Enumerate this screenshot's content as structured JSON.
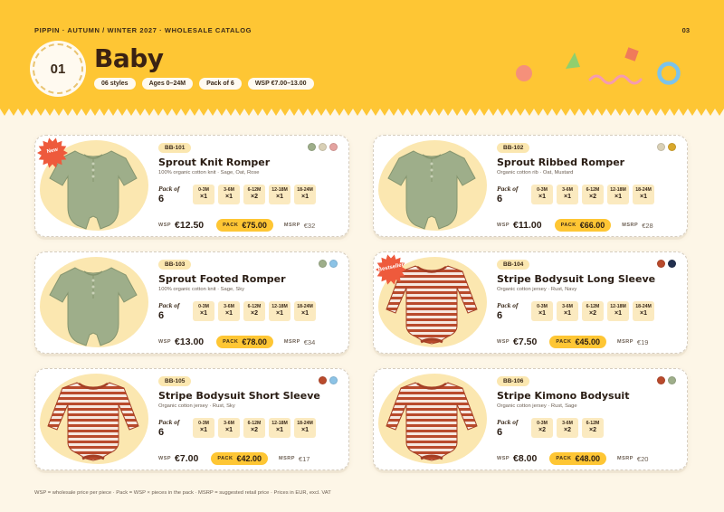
{
  "header": {
    "eyebrow": "PIPPIN · AUTUMN / WINTER 2027 · WHOLESALE CATALOG",
    "page_number": "03",
    "section_number": "01",
    "title": "Baby",
    "pills": [
      "06 styles",
      "Ages 0–24M",
      "Pack of 6",
      "WSP €7.00–13.00"
    ]
  },
  "colors": {
    "header_bg": "#fec634",
    "page_bg": "#fdf6e7",
    "sage": "#9eae8a",
    "oatmeal": "#d9d0b6",
    "rose": "#e4a3a0",
    "mustard": "#d9a82c",
    "sky": "#8cc3e6",
    "rust": "#b94a2c",
    "navy": "#23304f",
    "sticker": "#ee5a3c"
  },
  "labels": {
    "pack_of": "Pack of",
    "wsp": "WSP",
    "pack": "PACK",
    "msrp": "MSRP"
  },
  "products": [
    {
      "sku": "BB-101",
      "name": "Sprout Knit Romper",
      "desc": "100% organic cotton knit · Sage, Oat, Rose",
      "badge": "New",
      "swatches": [
        "#9eae8a",
        "#d9d0b6",
        "#e4a3a0"
      ],
      "garment": "romper-sage",
      "pack": "6",
      "sizes": [
        {
          "size": "0-3M",
          "qty": "×1"
        },
        {
          "size": "3-6M",
          "qty": "×1"
        },
        {
          "size": "6-12M",
          "qty": "×2"
        },
        {
          "size": "12-18M",
          "qty": "×1"
        },
        {
          "size": "18-24M",
          "qty": "×1"
        }
      ],
      "wsp": "€12.50",
      "pack_price": "€75.00",
      "msrp": "€32"
    },
    {
      "sku": "BB-102",
      "name": "Sprout Ribbed Romper",
      "desc": "Organic cotton rib · Oat, Mustard",
      "badge": "",
      "swatches": [
        "#d9d0b6",
        "#d9a82c"
      ],
      "garment": "romper-sage",
      "pack": "6",
      "sizes": [
        {
          "size": "0-3M",
          "qty": "×1"
        },
        {
          "size": "3-6M",
          "qty": "×1"
        },
        {
          "size": "6-12M",
          "qty": "×2"
        },
        {
          "size": "12-18M",
          "qty": "×1"
        },
        {
          "size": "18-24M",
          "qty": "×1"
        }
      ],
      "wsp": "€11.00",
      "pack_price": "€66.00",
      "msrp": "€28"
    },
    {
      "sku": "BB-103",
      "name": "Sprout Footed Romper",
      "desc": "100% organic cotton knit · Sage, Sky",
      "badge": "",
      "swatches": [
        "#9eae8a",
        "#8cc3e6"
      ],
      "garment": "romper-sage",
      "pack": "6",
      "sizes": [
        {
          "size": "0-3M",
          "qty": "×1"
        },
        {
          "size": "3-6M",
          "qty": "×1"
        },
        {
          "size": "6-12M",
          "qty": "×2"
        },
        {
          "size": "12-18M",
          "qty": "×1"
        },
        {
          "size": "18-24M",
          "qty": "×1"
        }
      ],
      "wsp": "€13.00",
      "pack_price": "€78.00",
      "msrp": "€34"
    },
    {
      "sku": "BB-104",
      "name": "Stripe Bodysuit Long Sleeve",
      "desc": "Organic cotton jersey · Rust, Navy",
      "badge": "Bestseller",
      "swatches": [
        "#b94a2c",
        "#23304f"
      ],
      "garment": "bodysuit-stripe",
      "pack": "6",
      "sizes": [
        {
          "size": "0-3M",
          "qty": "×1"
        },
        {
          "size": "3-6M",
          "qty": "×1"
        },
        {
          "size": "6-12M",
          "qty": "×2"
        },
        {
          "size": "12-18M",
          "qty": "×1"
        },
        {
          "size": "18-24M",
          "qty": "×1"
        }
      ],
      "wsp": "€7.50",
      "pack_price": "€45.00",
      "msrp": "€19"
    },
    {
      "sku": "BB-105",
      "name": "Stripe Bodysuit Short Sleeve",
      "desc": "Organic cotton jersey · Rust, Sky",
      "badge": "",
      "swatches": [
        "#b94a2c",
        "#8cc3e6"
      ],
      "garment": "bodysuit-stripe",
      "pack": "6",
      "sizes": [
        {
          "size": "0-3M",
          "qty": "×1"
        },
        {
          "size": "3-6M",
          "qty": "×1"
        },
        {
          "size": "6-12M",
          "qty": "×2"
        },
        {
          "size": "12-18M",
          "qty": "×1"
        },
        {
          "size": "18-24M",
          "qty": "×1"
        }
      ],
      "wsp": "€7.00",
      "pack_price": "€42.00",
      "msrp": "€17"
    },
    {
      "sku": "BB-106",
      "name": "Stripe Kimono Bodysuit",
      "desc": "Organic cotton jersey · Rust, Sage",
      "badge": "",
      "swatches": [
        "#b94a2c",
        "#9eae8a"
      ],
      "garment": "bodysuit-stripe",
      "pack": "6",
      "sizes": [
        {
          "size": "0-3M",
          "qty": "×2"
        },
        {
          "size": "3-6M",
          "qty": "×2"
        },
        {
          "size": "6-12M",
          "qty": "×2"
        }
      ],
      "wsp": "€8.00",
      "pack_price": "€48.00",
      "msrp": "€20"
    }
  ],
  "footnote": "WSP = wholesale price per piece · Pack = WSP × pieces in the pack · MSRP = suggested retail price · Prices in EUR, excl. VAT"
}
